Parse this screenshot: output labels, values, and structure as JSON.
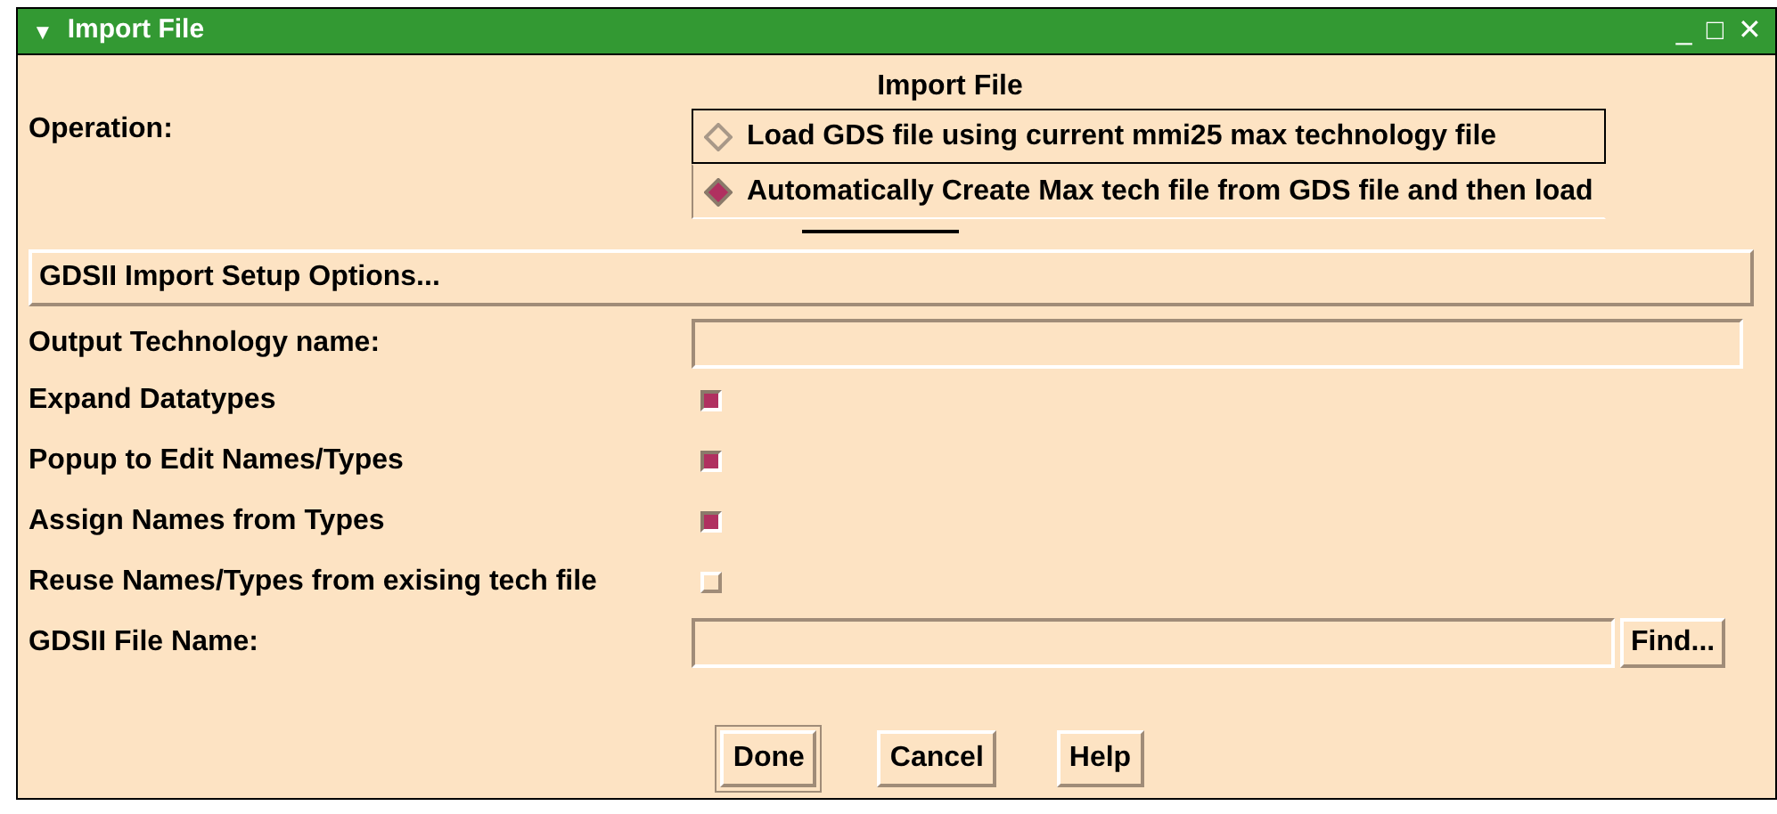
{
  "window": {
    "title": "Import File",
    "collapse_icon": "▼",
    "minimize": "_",
    "maximize": "□",
    "close": "✕"
  },
  "heading": "Import File",
  "operation": {
    "label": "Operation:",
    "options": [
      {
        "label": "Load GDS file using current mmi25 max technology file",
        "selected": false,
        "focused": true
      },
      {
        "label": "Automatically Create Max tech file from GDS file and then load",
        "selected": true,
        "focused": false
      }
    ]
  },
  "setup_button": "GDSII Import Setup Options...",
  "output_name": {
    "label": "Output Technology name:"
  },
  "options": [
    {
      "label": "Expand Datatypes",
      "checked": true
    },
    {
      "label": "Popup to Edit Names/Types",
      "checked": true
    },
    {
      "label": "Assign Names from Types",
      "checked": true
    },
    {
      "label": "Reuse Names/Types from exising tech file",
      "checked": false
    }
  ],
  "file_name": {
    "label": "GDSII File Name:",
    "find": "Find..."
  },
  "buttons": [
    {
      "label": "Done",
      "default": true
    },
    {
      "label": "Cancel",
      "default": false
    },
    {
      "label": "Help",
      "default": false
    }
  ]
}
